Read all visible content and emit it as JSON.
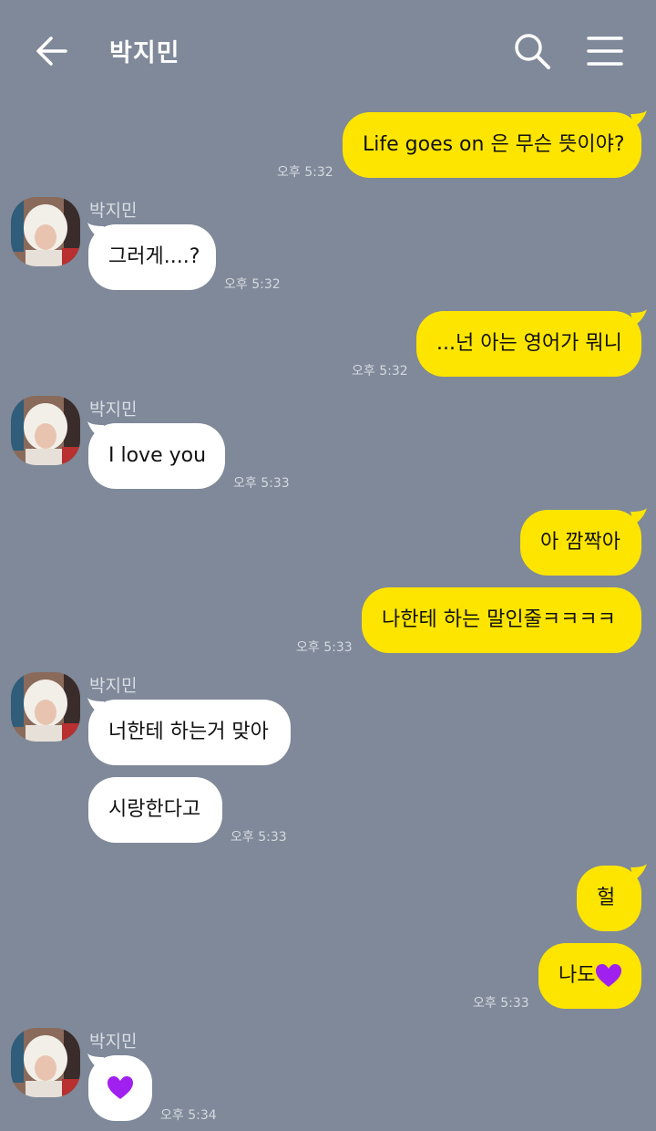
{
  "header": {
    "title": "박지민"
  },
  "contact": {
    "name": "박지민"
  },
  "messages": {
    "m1": {
      "text": "Life goes on 은 무슨 뜻이야?",
      "time": "오후 5:32"
    },
    "m2": {
      "text": "그러게....?",
      "time": "오후 5:32"
    },
    "m3": {
      "text": "...넌 아는 영어가 뭐니",
      "time": "오후 5:32"
    },
    "m4": {
      "text": "I love you",
      "time": "오후 5:33"
    },
    "m5": {
      "text": "아 깜짝아"
    },
    "m6": {
      "text": "나한테 하는 말인줄ㅋㅋㅋㅋ",
      "time": "오후 5:33"
    },
    "m7": {
      "text": "너한테 하는거 맞아"
    },
    "m8": {
      "text": "시랑한다고",
      "time": "오후 5:33"
    },
    "m9": {
      "text": "헐"
    },
    "m10": {
      "text": "나도",
      "emoji": "purple-heart",
      "time": "오후 5:33"
    },
    "m11": {
      "emoji": "purple-heart",
      "time": "오후 5:34"
    }
  },
  "colors": {
    "background": "#7f8999",
    "outgoing": "#fee500",
    "incoming": "#ffffff",
    "heart": "#a020f0"
  },
  "icons": [
    "back-arrow-icon",
    "search-icon",
    "menu-icon",
    "purple-heart-icon"
  ]
}
